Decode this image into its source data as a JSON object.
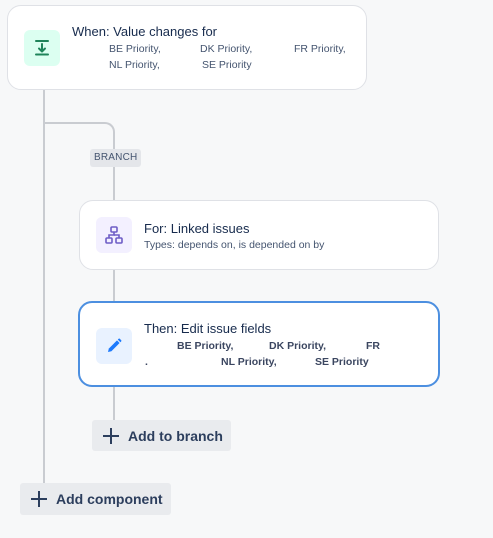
{
  "trigger": {
    "title": "When: Value changes for",
    "fields": [
      "BE Priority,",
      "DK Priority,",
      "FR Priority,",
      "NL Priority,",
      "SE Priority"
    ],
    "icon": "value-change-trigger-icon",
    "icon_color": "#1f845a",
    "icon_bg": "#dcfff1"
  },
  "branch": {
    "label": "BRANCH"
  },
  "branch_card": {
    "title": "For: Linked issues",
    "subtitle": "Types: depends on, is depended on by",
    "icon": "branch-hierarchy-icon",
    "icon_color": "#6e5dc6",
    "icon_bg": "#f3f0ff"
  },
  "action": {
    "title": "Then: Edit issue fields",
    "fields": [
      "BE Priority,",
      "DK Priority,",
      "FR",
      ".",
      "NL Priority,",
      "SE Priority"
    ],
    "icon": "pencil-edit-icon",
    "icon_color": "#1d7afc",
    "icon_bg": "#e9f2ff",
    "selected_border": "#4c8fe0"
  },
  "buttons": {
    "add_to_branch": "Add to branch",
    "add_component": "Add component"
  }
}
